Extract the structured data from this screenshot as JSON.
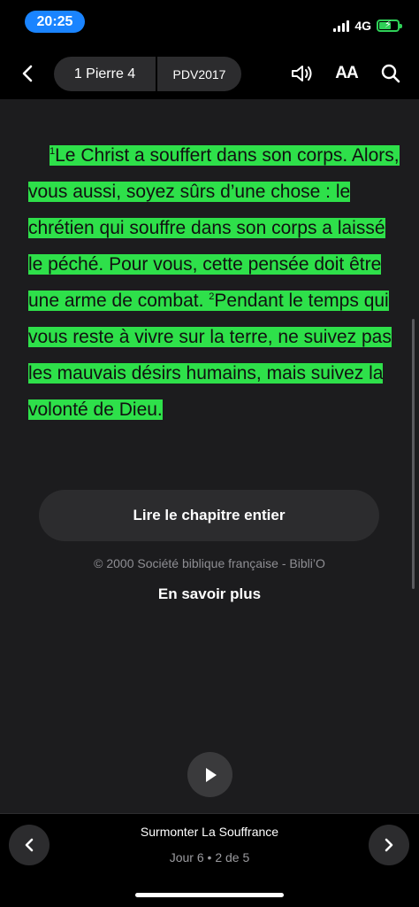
{
  "status": {
    "time": "20:25",
    "network": "4G"
  },
  "header": {
    "book": "1 Pierre 4",
    "version": "PDV2017"
  },
  "verse": {
    "v1_number": "1",
    "v1_text": "Le Christ a souffert dans son corps. Alors, vous aussi, soyez sûrs d’une chose : le chrétien qui souffre dans son corps a laissé le péché. Pour vous, cette pensée doit être une arme de combat.",
    "v2_number": "2",
    "v2_text": "Pendant le temps qui vous reste à vivre sur la terre, ne suivez pas les mauvais désirs humains, mais suivez la volonté de Dieu.",
    "highlight_color": "#2ee04a"
  },
  "actions": {
    "read_chapter": "Lire le chapitre entier",
    "copyright": "© 2000 Société biblique française - Bibli’O",
    "learn_more": "En savoir plus"
  },
  "plan": {
    "title": "Surmonter La Souffrance",
    "progress": "Jour 6 • 2 de 5"
  },
  "icons": [
    "back-chevron-icon",
    "speaker-icon",
    "text-size-icon",
    "search-icon",
    "play-icon",
    "chevron-left-icon",
    "chevron-right-icon"
  ]
}
